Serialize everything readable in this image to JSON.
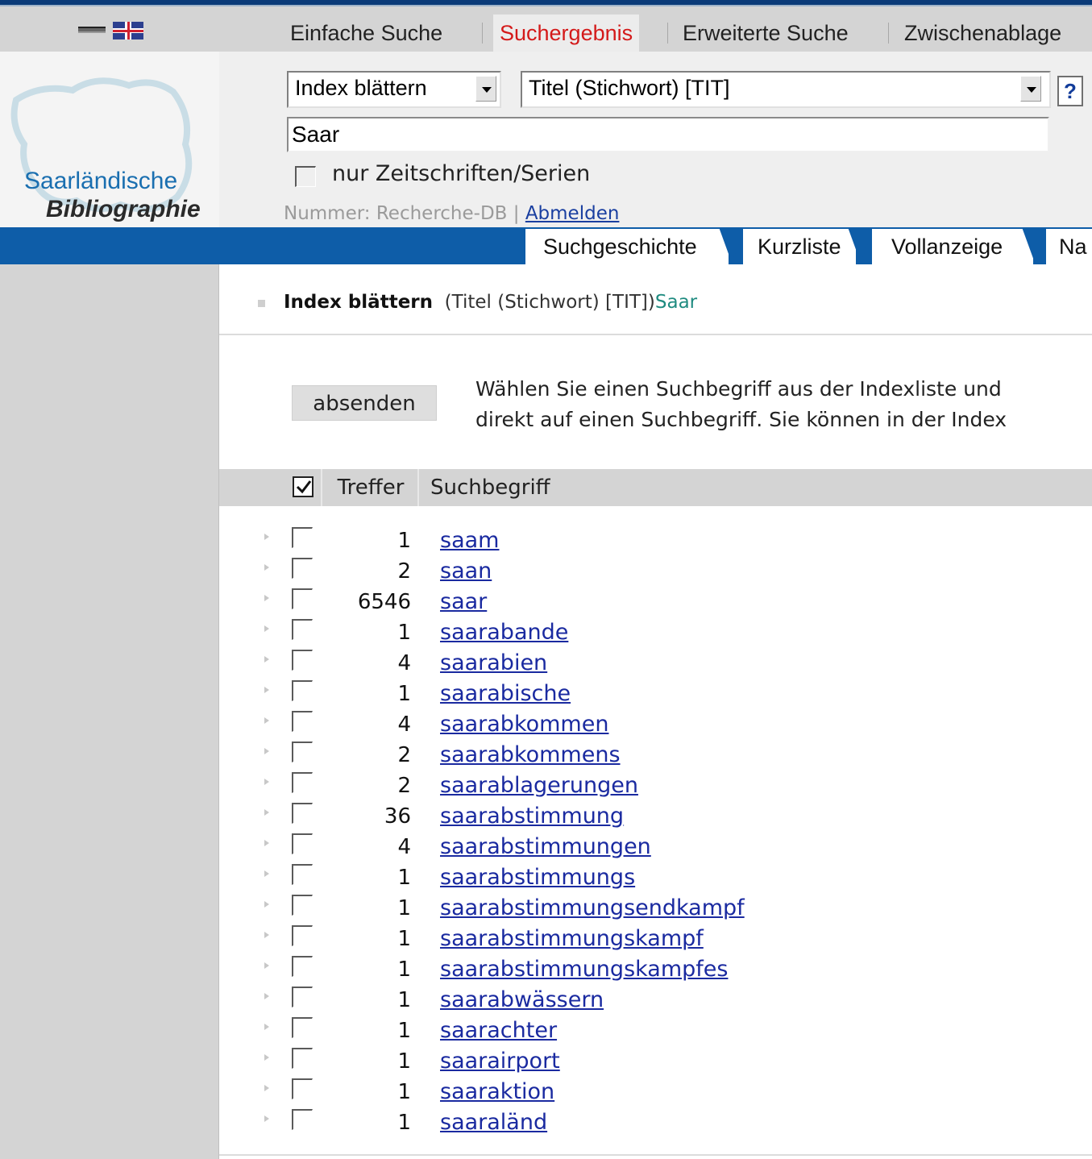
{
  "logo": {
    "line1": "Saarländische",
    "line2": "Bibliographie"
  },
  "tabs": [
    {
      "label": "Einfache Suche",
      "active": false
    },
    {
      "label": "Suchergebnis",
      "active": true
    },
    {
      "label": "Erweiterte Suche",
      "active": false
    },
    {
      "label": "Zwischenablage",
      "active": false
    }
  ],
  "search": {
    "mode_select": "Index blättern",
    "field_select": "Titel (Stichwort) [TIT]",
    "help_label": "?",
    "query": "Saar",
    "only_journals_label": "nur Zeitschriften/Serien",
    "nummer_label": "Nummer: Recherche-DB |",
    "logout_label": "Abmelden"
  },
  "nav_tabs": [
    "Suchgeschichte",
    "Kurzliste",
    "Vollanzeige",
    "Na"
  ],
  "breadcrumb": {
    "mode": "Index blättern",
    "index": "(Titel (Stichwort) [TIT])",
    "term": "Saar"
  },
  "submit_label": "absenden",
  "hint_lines": [
    "Wählen Sie einen Suchbegriff aus der Indexliste und",
    "direkt auf einen Suchbegriff. Sie können in der Index"
  ],
  "table": {
    "col_hits": "Treffer",
    "col_term": "Suchbegriff",
    "rows": [
      {
        "count": "1",
        "term": "saam"
      },
      {
        "count": "2",
        "term": "saan"
      },
      {
        "count": "6546",
        "term": "saar"
      },
      {
        "count": "1",
        "term": "saarabande"
      },
      {
        "count": "4",
        "term": "saarabien"
      },
      {
        "count": "1",
        "term": "saarabische"
      },
      {
        "count": "4",
        "term": "saarabkommen"
      },
      {
        "count": "2",
        "term": "saarabkommens"
      },
      {
        "count": "2",
        "term": "saarablagerungen"
      },
      {
        "count": "36",
        "term": "saarabstimmung"
      },
      {
        "count": "4",
        "term": "saarabstimmungen"
      },
      {
        "count": "1",
        "term": "saarabstimmungs"
      },
      {
        "count": "1",
        "term": "saarabstimmungsendkampf"
      },
      {
        "count": "1",
        "term": "saarabstimmungskampf"
      },
      {
        "count": "1",
        "term": "saarabstimmungskampfes"
      },
      {
        "count": "1",
        "term": "saarabwässern"
      },
      {
        "count": "1",
        "term": "saarachter"
      },
      {
        "count": "1",
        "term": "saarairport"
      },
      {
        "count": "1",
        "term": "saaraktion"
      },
      {
        "count": "1",
        "term": "saaraländ"
      }
    ]
  },
  "colors": {
    "accent_blue": "#0e5da8",
    "active_tab": "#d41a1a",
    "link": "#1a2aa0",
    "term_teal": "#1f8b80"
  }
}
